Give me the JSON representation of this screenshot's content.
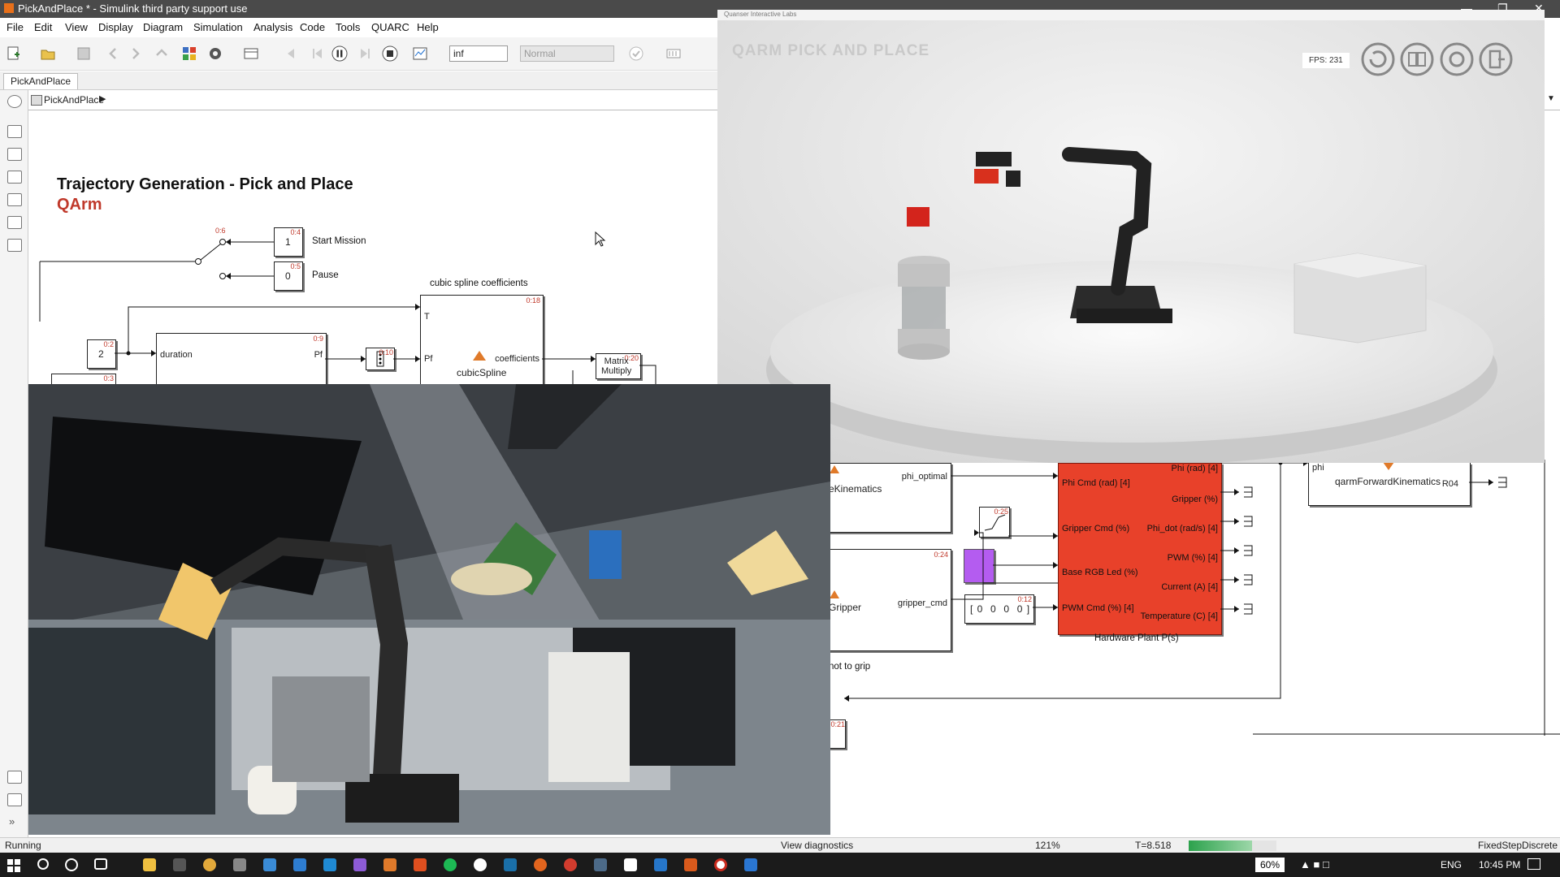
{
  "window": {
    "title": "PickAndPlace * - Simulink third party support use"
  },
  "menu": [
    "File",
    "Edit",
    "View",
    "Display",
    "Diagram",
    "Simulation",
    "Analysis",
    "Code",
    "Tools",
    "QUARC",
    "Help"
  ],
  "toolbar": {
    "stop_time": "inf",
    "sim_mode": "Normal"
  },
  "tabs": {
    "model": "PickAndPlace"
  },
  "breadcrumb": {
    "model": "PickAndPlace"
  },
  "diagram": {
    "title": "Trajectory Generation - Pick and Place",
    "subtitle": "QArm",
    "const_start": "1",
    "start_label": "Start Mission",
    "tag_start": "0:4",
    "const_pause": "0",
    "pause_label": "Pause",
    "tag_pause": "0:5",
    "tag_switch": "0:6",
    "const_two": "2",
    "tag_two": "0:2",
    "tag_three": "0:3",
    "duration_port": "duration",
    "pf_port": "Pf",
    "tag_traj": "0:9",
    "tag_demux": "0:10",
    "spline_title": "cubic spline coefficients",
    "spline_t": "T",
    "spline_pf": "Pf",
    "spline_out": "coefficients",
    "spline_name": "cubicSpline",
    "tag_spline": "0:18",
    "matrix_name": "Matrix\nMultiply",
    "tag_matrix": "0:20",
    "ik_out": "phi_optimal",
    "ik_name": "eKinematics",
    "gripper_out": "gripper_cmd",
    "gripper_name": "Gripper",
    "tag_gripper": "0:24",
    "not_to_grip": "not to grip",
    "tag_sat": "0:25",
    "tag_pwm": "0:12",
    "pwm_value": "[ 0  0  0  0 ]",
    "tag_bottom": "0:21",
    "plant_in": [
      "Phi Cmd (rad) [4]",
      "Gripper Cmd (%)",
      "Base RGB Led (%)",
      "PWM Cmd (%) [4]"
    ],
    "plant_out": [
      "Phi (rad) [4]",
      "Gripper (%)",
      "Phi_dot (rad/s) [4]",
      "PWM (%) [4]",
      "Current (A) [4]",
      "Temperature (C) [4]"
    ],
    "plant_name": "Hardware Plant P(s)",
    "fk_in": "phi",
    "fk_name": "qarmForwardKinematics",
    "fk_out": "R04"
  },
  "qlabs": {
    "window_title": "Quanser Interactive Labs",
    "heading": "QARM PICK AND PLACE",
    "fps": "FPS: 231"
  },
  "status": {
    "state": "Running",
    "diagnostics": "View diagnostics",
    "zoom": "121%",
    "time": "T=8.518",
    "progress": 0.72,
    "solver": "FixedStepDiscrete"
  },
  "taskbar": {
    "battery": "60%",
    "lang": "ENG",
    "clock": "10:45 PM"
  },
  "colors": {
    "plant": "#e8412a",
    "qlabs_bg": "#e7e7e7",
    "title_red": "#c0392b",
    "led": "#b45cf0"
  }
}
